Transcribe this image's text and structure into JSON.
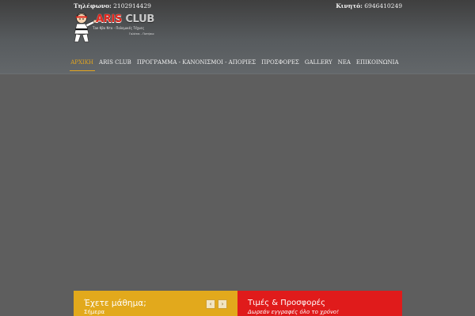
{
  "topbar": {
    "phone_label": "Τηλέφωνο:",
    "phone_value": "2102914429",
    "mobile_label": "Κινητό:",
    "mobile_value": "6946410249"
  },
  "logo": {
    "brand_word1": "ARIS",
    "brand_word2": "CLUB",
    "tagline": "Τae Kβο Ντο - Πολεμικές Τέχνες",
    "location": "Γαλάτσι - Πατήσια"
  },
  "nav": {
    "items": [
      {
        "label": "ΑΡΧΙΚΗ",
        "active": true
      },
      {
        "label": "ARIS CLUB"
      },
      {
        "label": "ΠΡΟΓΡΑΜΜΑ - ΚΑΝΟΝΙΣΜΟΙ - ΑΠΟΡΙΕΣ"
      },
      {
        "label": "ΠΡΟΣΦΟΡΕΣ"
      },
      {
        "label": "GALLERY"
      },
      {
        "label": "ΝΕΑ"
      },
      {
        "label": "ΕΠΙΚΟΙΝΩΝΙΑ"
      }
    ]
  },
  "panels": {
    "classes": {
      "title": "Έχετε μάθημα;",
      "subtitle": "Σήμερα",
      "prev_label": "‹",
      "next_label": "›"
    },
    "offers": {
      "title": "Τιμές & Προσφορές",
      "subtitle": "Δωρεάν εγγραφές όλο το χρόνο!"
    }
  },
  "colors": {
    "accent": "#e2a520",
    "yellow_panel": "#e2a91c",
    "red_panel": "#e01b1b",
    "background": "#5e5e5e"
  }
}
